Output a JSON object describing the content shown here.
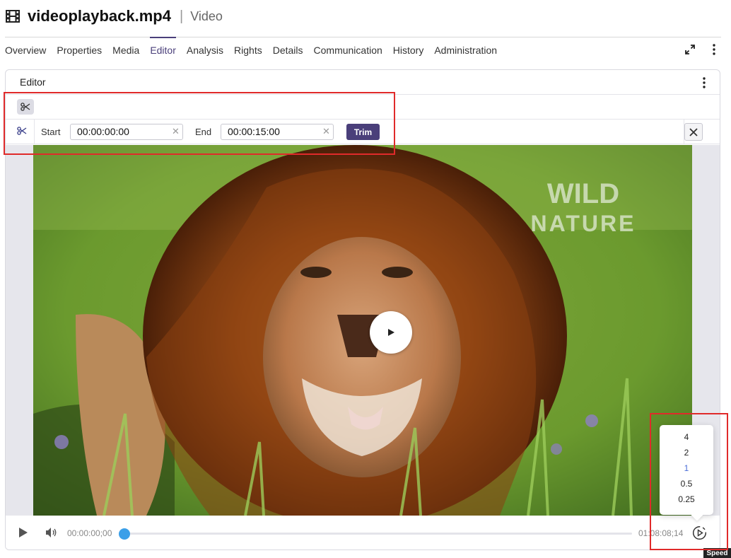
{
  "header": {
    "icon": "film-icon",
    "filename": "videoplayback.mp4",
    "separator": "|",
    "type": "Video"
  },
  "tabs": [
    {
      "label": "Overview",
      "active": false
    },
    {
      "label": "Properties",
      "active": false
    },
    {
      "label": "Media",
      "active": false
    },
    {
      "label": "Editor",
      "active": true
    },
    {
      "label": "Analysis",
      "active": false
    },
    {
      "label": "Rights",
      "active": false
    },
    {
      "label": "Details",
      "active": false
    },
    {
      "label": "Communication",
      "active": false
    },
    {
      "label": "History",
      "active": false
    },
    {
      "label": "Administration",
      "active": false
    }
  ],
  "editor": {
    "title": "Editor",
    "trim": {
      "start_label": "Start",
      "start_value": "00:00:00:00",
      "end_label": "End",
      "end_value": "00:00:15:00",
      "button_label": "Trim"
    }
  },
  "video": {
    "watermark_line1": "WILD",
    "watermark_line2": "NATURE"
  },
  "player": {
    "current_time": "00:00:00;00",
    "total_time": "01:08:08;14",
    "progress": 0,
    "speed_options": [
      "4",
      "2",
      "1",
      "0.5",
      "0.25"
    ],
    "speed_selected": "1",
    "tooltip": "Speed"
  },
  "colors": {
    "accent": "#4a3f7a",
    "scrubber": "#3b9fe8",
    "annotation": "#e02a2a",
    "speed_active": "#4a6dd8"
  }
}
